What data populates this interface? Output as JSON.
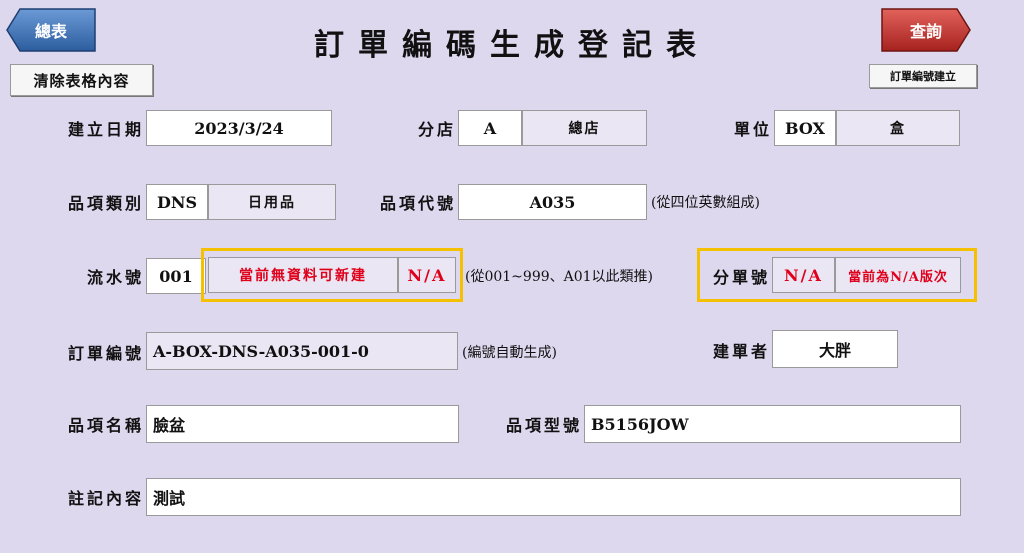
{
  "nav": {
    "back_label": "總表",
    "query_label": "查詢"
  },
  "title": "訂單編碼生成登記表",
  "buttons": {
    "clear_label": "清除表格內容",
    "create_label": "訂單編號建立"
  },
  "fields": {
    "create_date": {
      "label": "建立日期",
      "value": "2023/3/24"
    },
    "branch": {
      "label": "分店",
      "code": "A",
      "name": "總店"
    },
    "unit": {
      "label": "單位",
      "code": "BOX",
      "name": "盒"
    },
    "category": {
      "label": "品項類別",
      "code": "DNS",
      "name": "日用品"
    },
    "item_code": {
      "label": "品項代號",
      "value": "A035",
      "note": "(從四位英數組成)"
    },
    "serial": {
      "label": "流水號",
      "value": "001",
      "status": "當前無資料可新建",
      "flag": "N/A",
      "note": "(從001~999、A01以此類推)"
    },
    "sub_order": {
      "label": "分單號",
      "value": "N/A",
      "status": "當前為N/A版次"
    },
    "order_number": {
      "label": "訂單編號",
      "value": "A-BOX-DNS-A035-001-0",
      "note": "(編號自動生成)"
    },
    "creator": {
      "label": "建單者",
      "value": "大胖"
    },
    "item_name": {
      "label": "品項名稱",
      "value": "臉盆"
    },
    "item_model": {
      "label": "品項型號",
      "value": "B5156JOW"
    },
    "remarks": {
      "label": "註記內容",
      "value": "測試"
    }
  },
  "colors": {
    "background": "#ded8ee",
    "highlight": "#f5c000",
    "alert": "#e0001b",
    "back_button": "#3b6fb0",
    "query_button": "#c0302c"
  }
}
